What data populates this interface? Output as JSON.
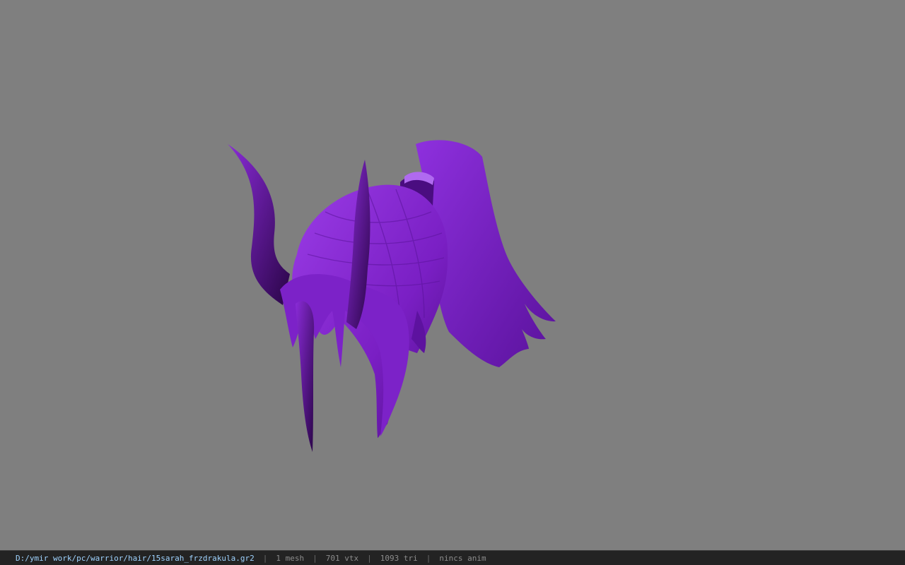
{
  "viewer": {
    "background_color": "#7f7f7f",
    "model_color": "#7a1fc4",
    "model_shadow_color": "#3a0a63",
    "model_highlight_color": "#9a3ce6"
  },
  "status": {
    "file_path": "D:/ymir work/pc/warrior/hair/15sarah_frzdrakula.gr2",
    "separator": "|",
    "mesh_count": "1 mesh",
    "vertex_count": "701 vtx",
    "triangle_count": "1093 tri",
    "anim_status": "nincs anim"
  }
}
